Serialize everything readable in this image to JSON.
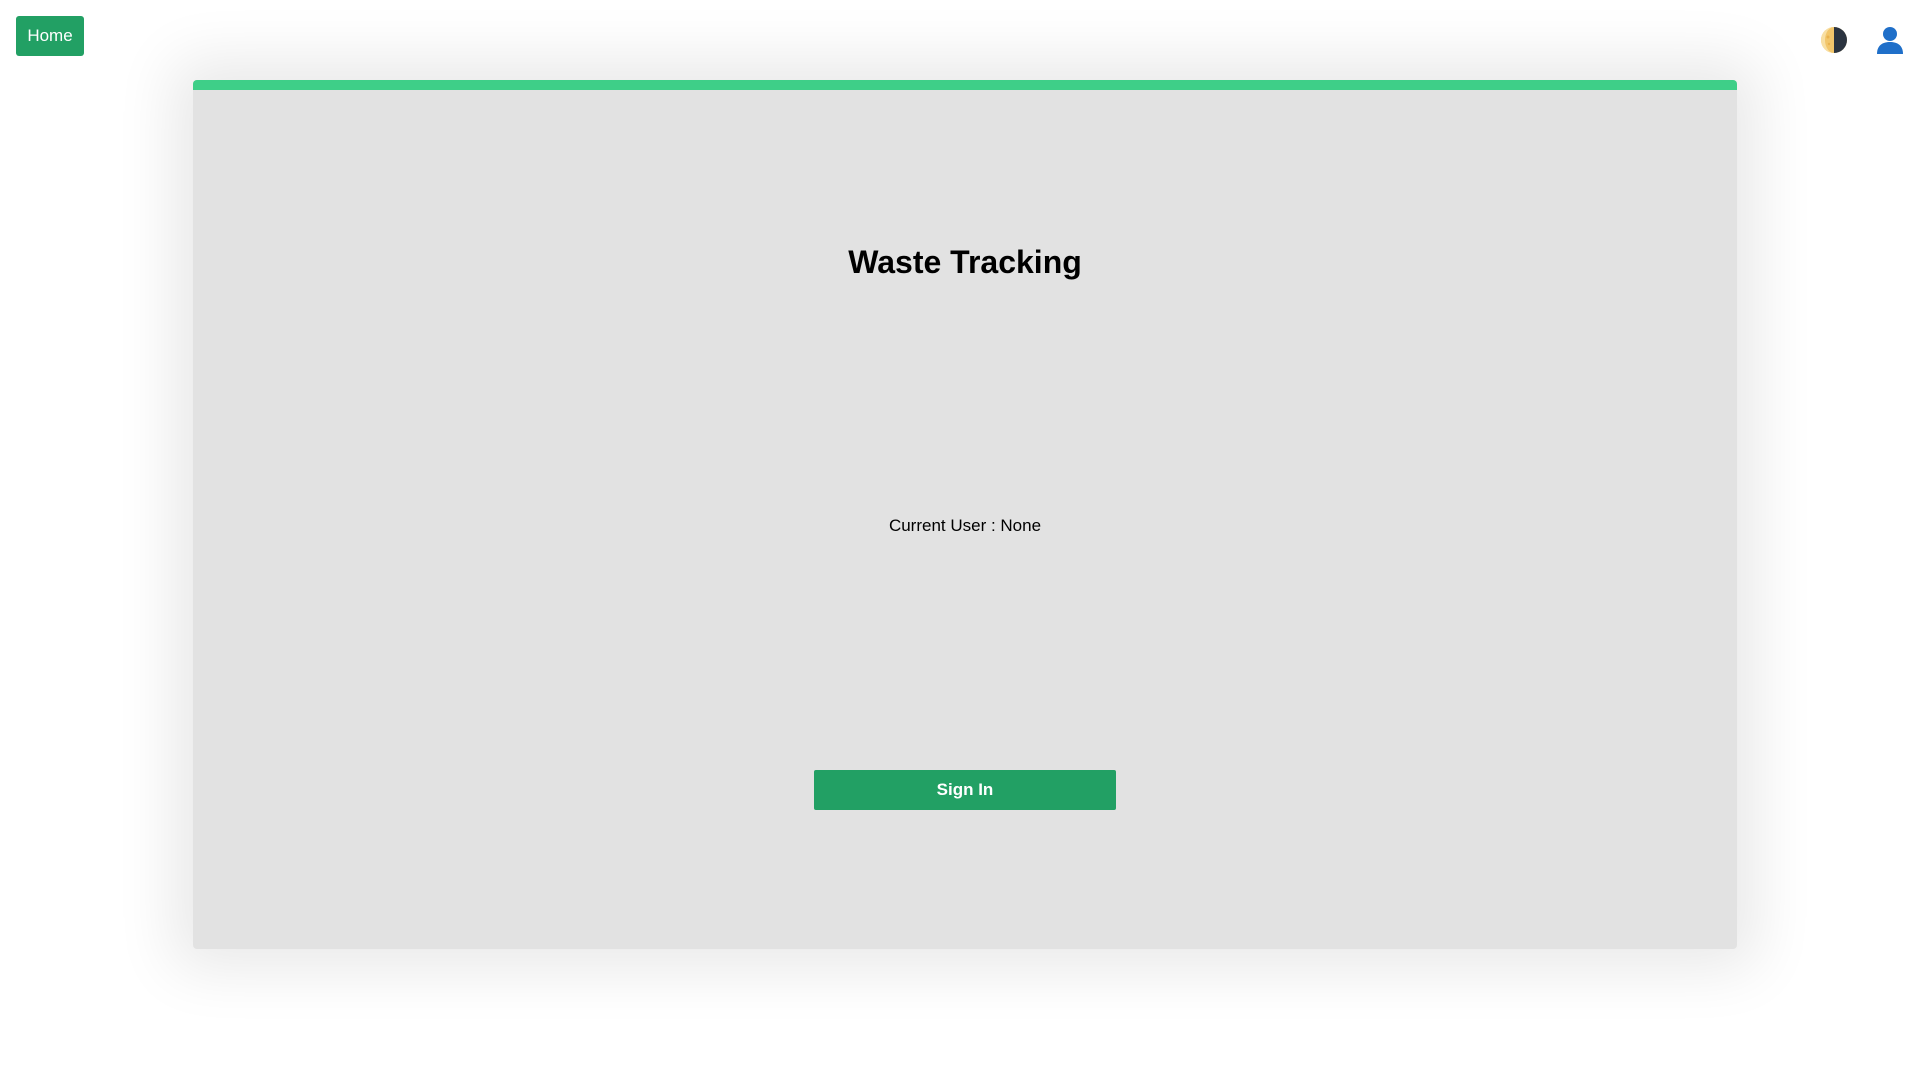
{
  "header": {
    "home_label": "Home",
    "theme_toggle_icon": "half-moon-contrast-icon",
    "user_icon": "user-silhouette-icon"
  },
  "main": {
    "title": "Waste Tracking",
    "current_user_label": "Current User : None",
    "sign_in_label": "Sign In"
  },
  "colors": {
    "primary_green": "#22a064",
    "accent_green": "#3ecf88",
    "card_background": "#e2e2e2",
    "page_background": "#ffffff",
    "user_icon_blue": "#1f6fc9"
  }
}
